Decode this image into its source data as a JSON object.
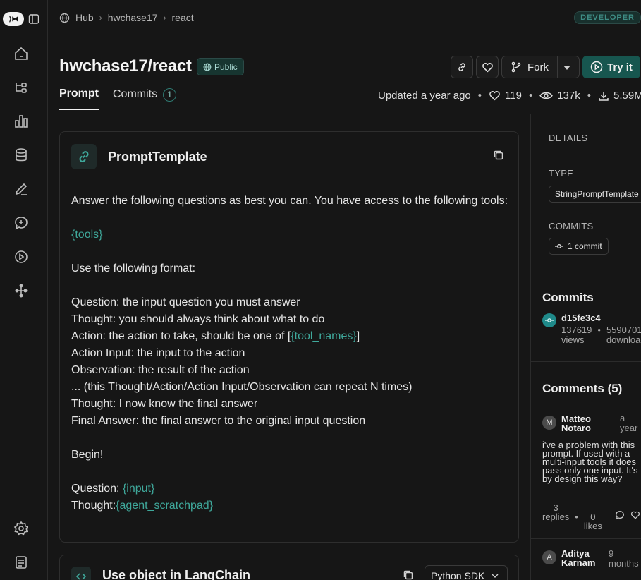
{
  "breadcrumb": {
    "hub": "Hub",
    "owner": "hwchase17",
    "repo": "react"
  },
  "badge": {
    "developer": "DEVELOPER",
    "public": "Public"
  },
  "title": "hwchase17/react",
  "actions": {
    "fork": "Fork",
    "try": "Try it"
  },
  "tabs": {
    "prompt": "Prompt",
    "commits": "Commits",
    "commits_count": "1"
  },
  "stats": {
    "updated": "Updated a year ago",
    "likes": "119",
    "views": "137k",
    "downloads": "5.59M"
  },
  "template_card": {
    "title": "PromptTemplate",
    "lines": {
      "l1": "Answer the following questions as best you can. You have access to the following tools:",
      "tools_var": "{tools}",
      "l3": "Use the following format:",
      "l4": "Question: the input question you must answer",
      "l5": "Thought: you should always think about what to do",
      "l6_pre": "Action: the action to take, should be one of [",
      "tool_names_var": "{tool_names}",
      "l6_post": "]",
      "l7": "Action Input: the input to the action",
      "l8": "Observation: the result of the action",
      "l9": "... (this Thought/Action/Action Input/Observation can repeat N times)",
      "l10": "Thought: I now know the final answer",
      "l11": "Final Answer: the final answer to the original input question",
      "l12": "Begin!",
      "l13_pre": "Question: ",
      "input_var": "{input}",
      "l14_pre": "Thought:",
      "scratch_var": "{agent_scratchpad}"
    }
  },
  "langchain_card": {
    "title": "Use object in LangChain",
    "sdk": "Python SDK"
  },
  "details": {
    "heading": "DETAILS",
    "type_label": "TYPE",
    "type_value": "StringPromptTemplate",
    "commits_label": "COMMITS",
    "commits_value": "1 commit"
  },
  "commits_panel": {
    "heading": "Commits",
    "hash": "d15fe3c4",
    "views": "137619",
    "views_label": "views",
    "downloads": "5590701",
    "downloads_label": "downloads"
  },
  "comments": {
    "heading": "Comments (5)",
    "c1": {
      "initial": "M",
      "name_1": "Matteo",
      "name_2": "Notaro",
      "time_1": "a",
      "time_2": "year",
      "text": "i've a problem with this prompt. If used with a multi-input tools it does pass only one input. It's by design this way?",
      "replies_num": "3",
      "replies_label": "replies",
      "likes_num": "0",
      "likes_label": "likes"
    },
    "c2": {
      "initial": "A",
      "name_1": "Aditya",
      "name_2": "Karnam",
      "time_1": "9",
      "time_2": "months"
    }
  },
  "colors": {
    "accent": "#3fa89b",
    "background": "#161616",
    "try_button": "#17564f"
  }
}
